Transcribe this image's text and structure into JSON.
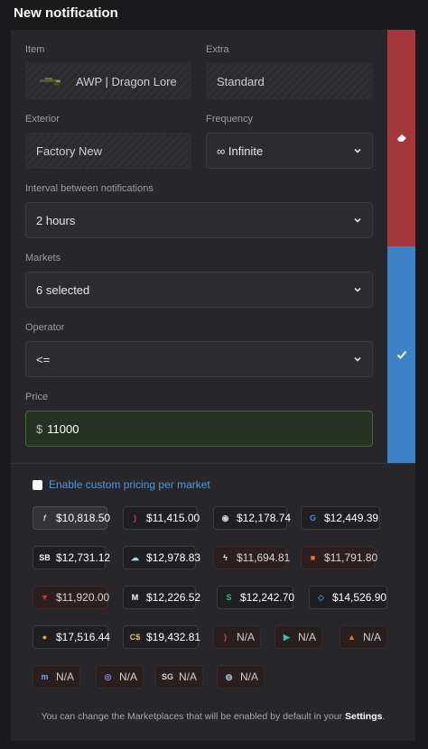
{
  "title": "New notification",
  "form": {
    "item_label": "Item",
    "item_value": "AWP | Dragon Lore",
    "extra_label": "Extra",
    "extra_value": "Standard",
    "exterior_label": "Exterior",
    "exterior_value": "Factory New",
    "frequency_label": "Frequency",
    "frequency_value": "∞ Infinite",
    "interval_label": "Interval between notifications",
    "interval_value": "2 hours",
    "markets_label": "Markets",
    "markets_value": "6 selected",
    "operator_label": "Operator",
    "operator_value": "<=",
    "price_label": "Price",
    "price_currency": "$",
    "price_value": "11000"
  },
  "custom_pricing_label": "Enable custom pricing per market",
  "markets": [
    {
      "price": "$10,818.50",
      "icon": "script-f-icon",
      "color": "#d7d7d7"
    },
    {
      "price": "$11,415.00",
      "icon": "paren-icon",
      "color": "#e0307a"
    },
    {
      "price": "$12,178.74",
      "icon": "soldier-icon",
      "color": "#cfd3da"
    },
    {
      "price": "$12,449.39",
      "icon": "g-circle-icon",
      "color": "#3b8de0"
    },
    {
      "price": "$12,731.12",
      "icon": "sb-icon",
      "color": "#ffffff"
    },
    {
      "price": "$12,978.83",
      "icon": "cloud-icon",
      "color": "#9fd3f0"
    },
    {
      "price": "$11,694.81",
      "icon": "bolt-icon",
      "color": "#ffffff"
    },
    {
      "price": "$11,791.80",
      "icon": "orange-box-icon",
      "color": "#e8762d"
    },
    {
      "price": "$11,920.00",
      "icon": "red-v-icon",
      "color": "#e0303a"
    },
    {
      "price": "$12,226.52",
      "icon": "m-swoosh-icon",
      "color": "#ffffff"
    },
    {
      "price": "$12,242.70",
      "icon": "green-s-icon",
      "color": "#2fbf71"
    },
    {
      "price": "$14,526.90",
      "icon": "diamond-code-icon",
      "color": "#3b8de0"
    },
    {
      "price": "$17,516.44",
      "icon": "gold-coin-icon",
      "color": "#e0b020"
    },
    {
      "price": "$19,432.81",
      "icon": "cs-dollar-icon",
      "color": "#f0c040"
    },
    {
      "price": "N/A",
      "icon": "paren-icon",
      "color": "#e0307a"
    },
    {
      "price": "N/A",
      "icon": "teal-arrow-icon",
      "color": "#2fc9a8"
    },
    {
      "price": "N/A",
      "icon": "fox-icon",
      "color": "#e8762d"
    },
    {
      "price": "N/A",
      "icon": "m-blue-icon",
      "color": "#6aa8ff"
    },
    {
      "price": "N/A",
      "icon": "globe-icon",
      "color": "#7b8be0"
    },
    {
      "price": "N/A",
      "icon": "sg-icon",
      "color": "#cfd3da"
    },
    {
      "price": "N/A",
      "icon": "swirl-icon",
      "color": "#9fb8c8"
    }
  ],
  "footer": {
    "text": "You can change the Marketplaces that will be enabled by default in your",
    "link": "Settings",
    "end": "."
  },
  "colors": {
    "delete": "#a6383b",
    "confirm": "#3b83c6",
    "accent": "#4d9ae0",
    "price_border": "#3f6b34"
  }
}
